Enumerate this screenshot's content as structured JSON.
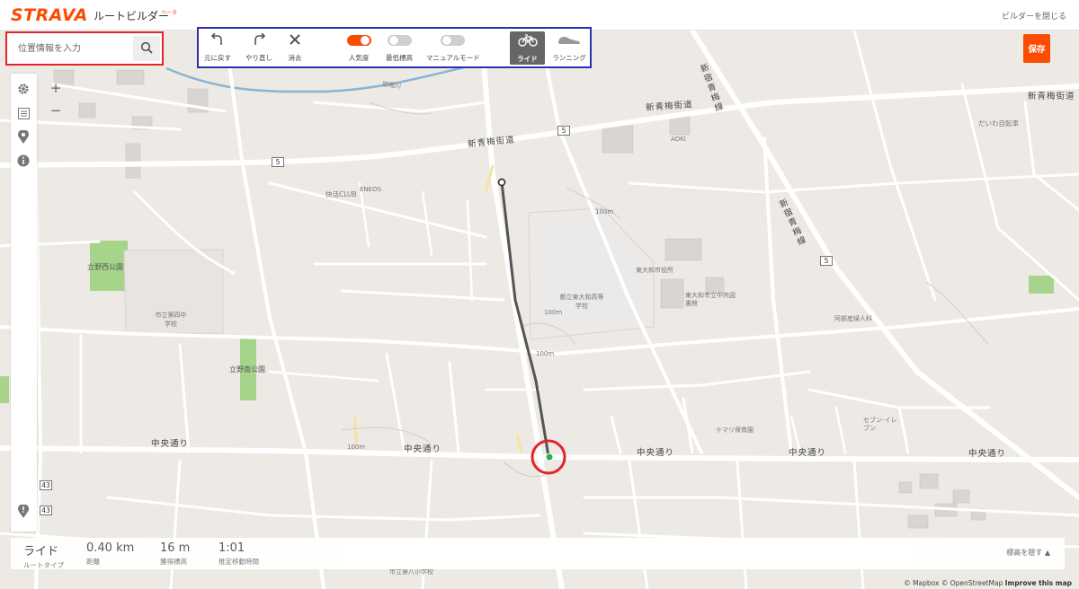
{
  "header": {
    "brand": "STRAVA",
    "app_name": "ルートビルダー",
    "beta": "ベータ",
    "close_link": "ビルダーを閉じる"
  },
  "search": {
    "placeholder": "位置情報を入力",
    "icon": "search-icon"
  },
  "toolbar": {
    "undo": "元に戻す",
    "redo": "やり直し",
    "clear": "消去",
    "popularity": "人気度",
    "min_elevation": "最低標高",
    "manual_mode": "マニュアルモード",
    "ride": "ライド",
    "running": "ランニング",
    "popularity_on": true,
    "min_elevation_on": false,
    "manual_mode_on": false,
    "active_mode": "ライド"
  },
  "save_button": "保存",
  "side_controls": {
    "icons": [
      "gear-icon",
      "list-icon",
      "map-pin-icon",
      "info-icon",
      "warning-icon"
    ],
    "zoom_in": "+",
    "zoom_out": "−"
  },
  "stats": {
    "activity": "ライド",
    "activity_label": "ルートタイプ",
    "distance": "0.40 km",
    "distance_label": "距離",
    "elevation": "16 m",
    "elevation_label": "獲得標高",
    "time": "1:01",
    "time_label": "推定移動時間",
    "elevation_toggle": "標高を隠す ▲"
  },
  "attribution": {
    "text": "© Mapbox © OpenStreetMap",
    "improve": "Improve this map"
  },
  "map_labels": {
    "shinome": "新青梅街道",
    "chuo1": "中央通り",
    "chuo2": "中央通り",
    "chuo3": "中央通り",
    "chuo4": "中央通り",
    "chuo5": "中央通り",
    "shinjuku_aome": "新宿青梅線",
    "shinjuku_aome2": "新宿青梅線",
    "tachino_nishi_park": "立野西公園",
    "tachino_minami_park": "立野南公園",
    "school1": "市立第四中学校",
    "school2": "都立東大和高等学校",
    "city_office": "東大和市役所",
    "library": "東大和市立中央図書館",
    "club": "快活CLUB",
    "eneos": "ENEOS",
    "aoki": "AOKI",
    "daiwa": "だいわ自転車",
    "seven": "セブン-イレブン",
    "temari": "テマリ保育園",
    "clinic": "阿部産婦人科",
    "school3": "市立第八小学校",
    "shinome2": "新青梅街道",
    "river": "空堀川",
    "r5a": "5",
    "r5b": "5",
    "r5c": "5",
    "r43a": "43",
    "r43b": "43",
    "contour1": "100m",
    "contour2": "100m",
    "contour3": "100m",
    "contour4": "100m"
  }
}
